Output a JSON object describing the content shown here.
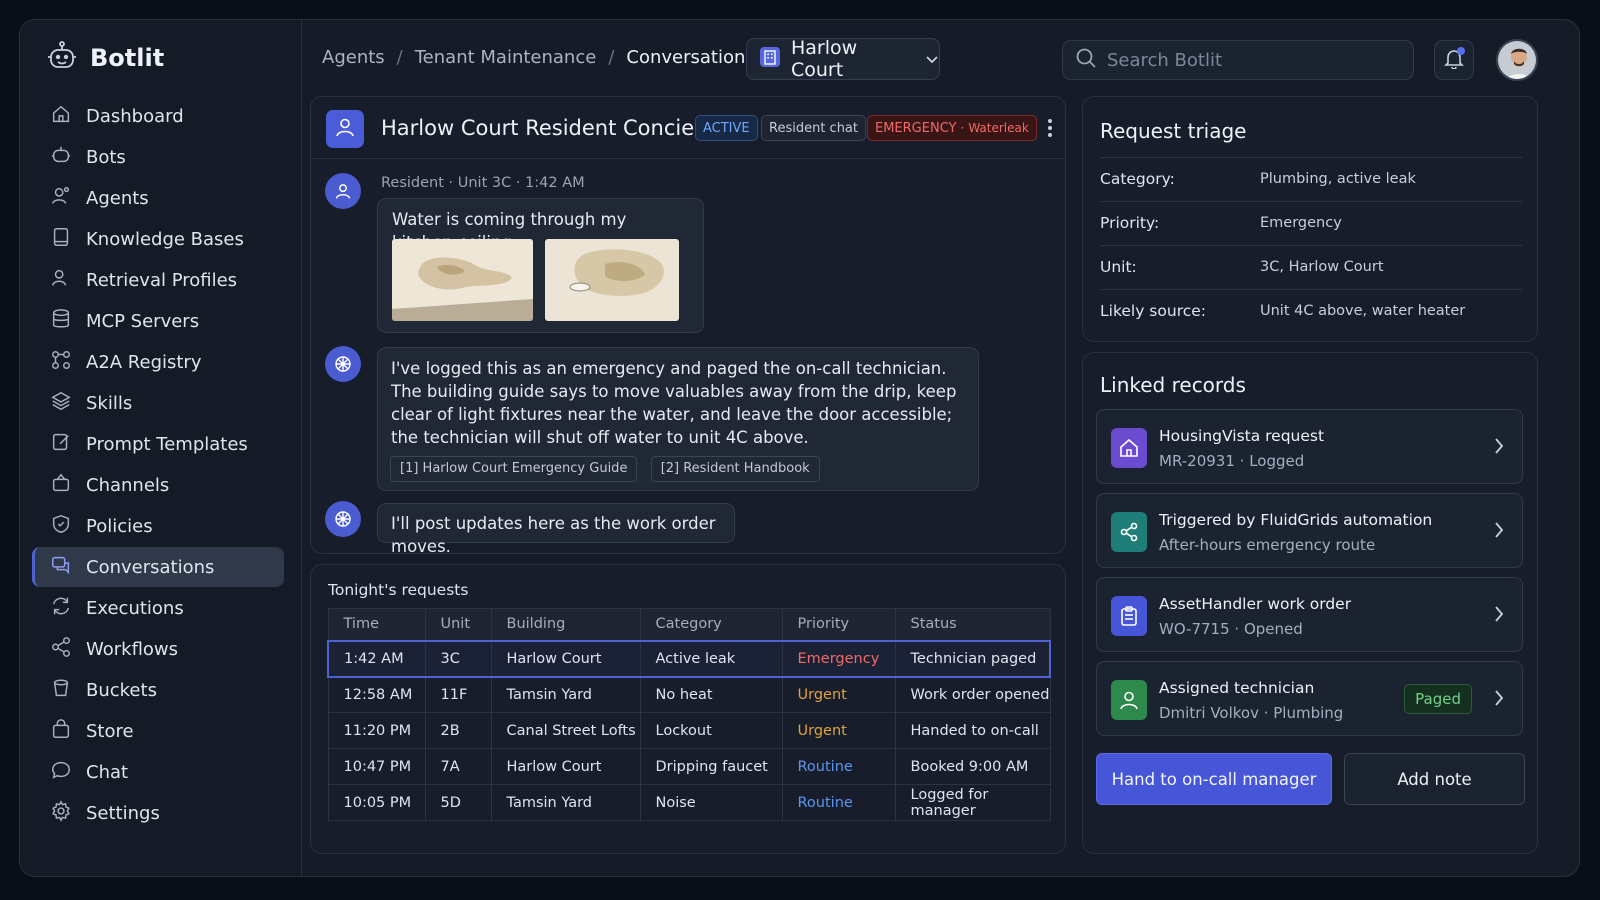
{
  "app": {
    "name": "Botlit"
  },
  "sidebar": {
    "items": [
      {
        "label": "Dashboard",
        "icon": "home-icon"
      },
      {
        "label": "Bots",
        "icon": "bot-icon"
      },
      {
        "label": "Agents",
        "icon": "agents-icon"
      },
      {
        "label": "Knowledge Bases",
        "icon": "book-icon"
      },
      {
        "label": "Retrieval Profiles",
        "icon": "profiles-icon"
      },
      {
        "label": "MCP Servers",
        "icon": "database-icon"
      },
      {
        "label": "A2A Registry",
        "icon": "registry-icon"
      },
      {
        "label": "Skills",
        "icon": "layers-icon"
      },
      {
        "label": "Prompt Templates",
        "icon": "edit-icon"
      },
      {
        "label": "Channels",
        "icon": "channels-icon"
      },
      {
        "label": "Policies",
        "icon": "shield-icon"
      },
      {
        "label": "Conversations",
        "icon": "chat-bubbles-icon",
        "active": true
      },
      {
        "label": "Executions",
        "icon": "refresh-icon"
      },
      {
        "label": "Workflows",
        "icon": "share-icon"
      },
      {
        "label": "Buckets",
        "icon": "bucket-icon"
      },
      {
        "label": "Store",
        "icon": "bag-icon"
      },
      {
        "label": "Chat",
        "icon": "chat-icon"
      },
      {
        "label": "Settings",
        "icon": "gear-icon"
      }
    ]
  },
  "header": {
    "breadcrumbs": [
      "Agents",
      "Tenant Maintenance",
      "Conversations"
    ],
    "building_select": "Harlow Court",
    "search_placeholder": "Search Botlit"
  },
  "chat": {
    "title": "Harlow Court Resident Concierge",
    "badges": {
      "active": "ACTIVE",
      "channel": "Resident chat",
      "emergency": "EMERGENCY",
      "emergency_sub": "Waterleak",
      "emergency_sep": "·"
    },
    "messages": [
      {
        "meta": "Resident · Unit 3C · 1:42 AM",
        "text": "Water is coming through my kitchen ceiling"
      },
      {
        "text": "I've logged this as an emergency and paged the on-call technician. The building guide says to move valuables away from the drip, keep clear of light fixtures near the water, and leave the door accessible; the technician will shut off water to unit 4C above.",
        "citations": [
          "[1] Harlow Court Emergency Guide",
          "[2] Resident Handbook"
        ]
      },
      {
        "text": "I'll post updates here as the work order moves."
      }
    ]
  },
  "requests": {
    "title": "Tonight's requests",
    "columns": [
      "Time",
      "Unit",
      "Building",
      "Category",
      "Priority",
      "Status"
    ],
    "rows": [
      [
        "1:42 AM",
        "3C",
        "Harlow Court",
        "Active leak",
        "Emergency",
        "Technician paged"
      ],
      [
        "12:58 AM",
        "11F",
        "Tamsin Yard",
        "No heat",
        "Urgent",
        "Work order opened"
      ],
      [
        "11:20 PM",
        "2B",
        "Canal Street Lofts",
        "Lockout",
        "Urgent",
        "Handed to on-call"
      ],
      [
        "10:47 PM",
        "7A",
        "Harlow Court",
        "Dripping faucet",
        "Routine",
        "Booked 9:00 AM"
      ],
      [
        "10:05 PM",
        "5D",
        "Tamsin Yard",
        "Noise",
        "Routine",
        "Logged for manager"
      ]
    ]
  },
  "triage": {
    "title": "Request triage",
    "rows": [
      {
        "label": "Category:",
        "value": "Plumbing, active leak"
      },
      {
        "label": "Priority:",
        "value": "Emergency"
      },
      {
        "label": "Unit:",
        "value": "3C, Harlow Court"
      },
      {
        "label": "Likely source:",
        "value": "Unit 4C above, water heater"
      }
    ]
  },
  "linked": {
    "title": "Linked records",
    "records": [
      {
        "title": "HousingVista request",
        "sub": "MR-20931 · Logged",
        "icon": "house-icon",
        "color": "#6b4bd0"
      },
      {
        "title": "Triggered by FluidGrids automation",
        "sub": "After-hours emergency route",
        "icon": "share-icon",
        "color": "#1f7f78"
      },
      {
        "title": "AssetHandler work order",
        "sub": "WO-7715 · Opened",
        "icon": "clipboard-icon",
        "color": "#4656d6"
      },
      {
        "title": "Assigned technician",
        "sub": "Dmitri Volkov · Plumbing",
        "icon": "person-icon",
        "color": "#2e8a4c",
        "badge": "Paged"
      }
    ],
    "primary_button": "Hand to on-call manager",
    "secondary_button": "Add note"
  },
  "colors": {
    "accent": "#4656d6",
    "emergency": "#f06a66",
    "urgent": "#e0a33a",
    "routine": "#5b95f0",
    "success": "#6fd18a"
  }
}
